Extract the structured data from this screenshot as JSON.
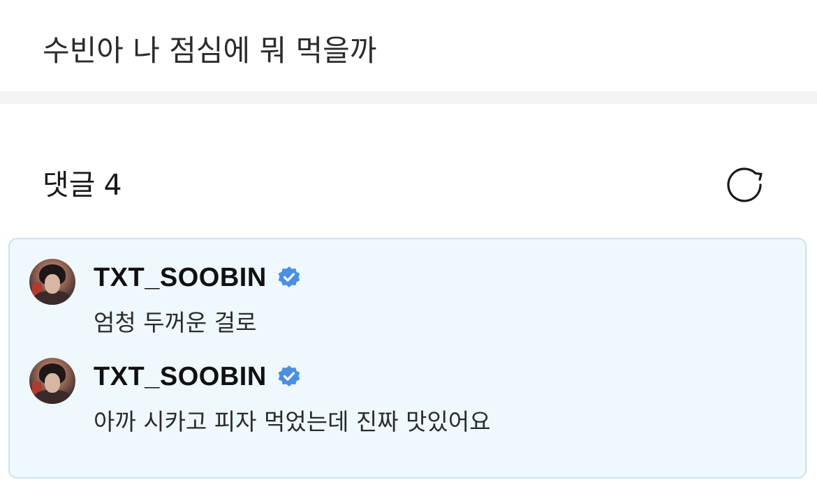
{
  "post": {
    "text": "수빈아 나 점심에 뭐 먹을까"
  },
  "comments_section": {
    "label": "댓글",
    "count": "4",
    "refresh_icon": "refresh-icon"
  },
  "comments": [
    {
      "username": "TXT_SOOBIN",
      "verified": true,
      "text": "엄청 두꺼운 걸로"
    },
    {
      "username": "TXT_SOOBIN",
      "verified": true,
      "text": "아까 시카고 피자 먹었는데 진짜 맛있어요"
    }
  ],
  "colors": {
    "comments_box_bg": "#eef8fd",
    "comments_box_border": "#cde2ec",
    "verified_badge": "#4a90e2",
    "divider": "#f3f4f6"
  }
}
